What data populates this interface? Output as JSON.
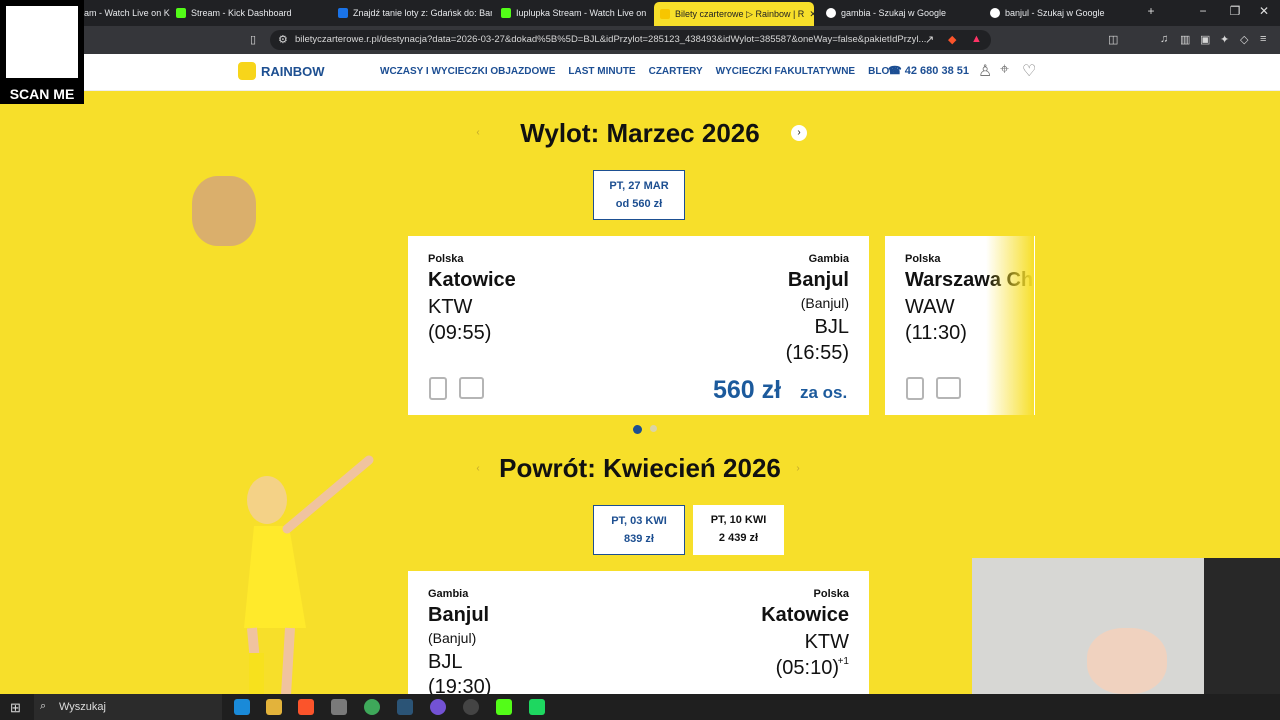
{
  "browser": {
    "tabs": [
      {
        "label": "am - Watch Live on K"
      },
      {
        "label": "Stream - Kick Dashboard"
      },
      {
        "label": "Znajdź tanie loty z: Gdańsk do: Bangk"
      },
      {
        "label": "Iuplupka Stream - Watch Live on Kic"
      },
      {
        "label": "Bilety czarterowe ▷ Rainbow | R"
      },
      {
        "label": "gambia - Szukaj w Google"
      },
      {
        "label": "banjul - Szukaj w Google"
      }
    ],
    "url": "biletyczarterowe.r.pl/destynacja?data=2026-03-27&dokad%5B%5D=BJL&idPrzylot=285123_438493&idWylot=385587&oneWay=false&pakietIdPrzyl..."
  },
  "overlay": {
    "scan_me": "SCAN ME"
  },
  "site": {
    "logo": "RAINBOW",
    "nav": [
      "WCZASY I WYCIECZKI OBJAZDOWE",
      "LAST MINUTE",
      "CZARTERY",
      "WYCIECZKI FAKULTATYWNE",
      "BLOG"
    ],
    "phone": "42 680 38 51"
  },
  "outbound": {
    "title": "Wylot: Marzec 2026",
    "date_button": {
      "label": "PT, 27 MAR",
      "price": "od  560 zł"
    },
    "card1": {
      "from_country": "Polska",
      "from_city": "Katowice",
      "from_code": "KTW",
      "from_time": "(09:55)",
      "to_country": "Gambia",
      "to_city": "Banjul",
      "to_city_alt": "(Banjul)",
      "to_code": "BJL",
      "to_time": "(16:55)",
      "price": "560 zł",
      "price_unit": "za os."
    },
    "card2": {
      "from_country": "Polska",
      "from_city": "Warszawa Ch",
      "from_code": "WAW",
      "from_time": "(11:30)"
    }
  },
  "inbound": {
    "title": "Powrót: Kwiecień 2026",
    "date_buttons": [
      {
        "label": "PT, 03 KWI",
        "price": "839 zł"
      },
      {
        "label": "PT, 10 KWI",
        "price": "2 439 zł"
      }
    ],
    "card": {
      "from_country": "Gambia",
      "from_city": "Banjul",
      "from_city_alt": "(Banjul)",
      "from_code": "BJL",
      "from_time": "(19:30)",
      "to_country": "Polska",
      "to_city": "Katowice",
      "to_code": "KTW",
      "to_time": "(05:10)",
      "to_time_suffix": "+1"
    }
  },
  "taskbar": {
    "search": "Wyszukaj"
  },
  "colors": {
    "accent_yellow": "#f7df2a",
    "brand_blue": "#1d4f91"
  }
}
